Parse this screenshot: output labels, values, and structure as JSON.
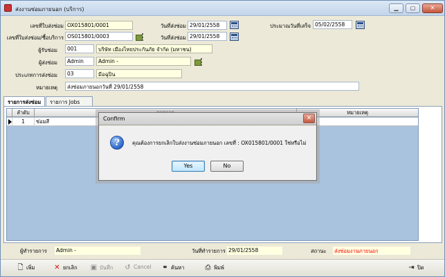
{
  "window": {
    "title": "ส่งงานซ่อมภายนอก (บริการ)",
    "controls": {
      "minimize": "▁",
      "maximize": "▢",
      "close": "✕"
    }
  },
  "form": {
    "doc_no_label": "เลขที่ใบส่งซ่อม",
    "doc_no_value": "OX015801/0001",
    "send_date_label": "วันที่ส่งซ่อม",
    "send_date_value": "29/01/2558",
    "est_finish_label": "ประมาณวันที่เสร็จ",
    "est_finish_value": "05/02/2558",
    "ref_no_label": "เลขที่ใบส่งซ่อม/ซื้อบริการ",
    "ref_no_value": "OS015801/0003",
    "ref_date_label": "วันที่ส่งซ่อม",
    "ref_date_value": "29/01/2558",
    "vendor_label": "ผู้รับซ่อม",
    "vendor_code": "001",
    "vendor_name": "บริษัท เมืองไทยประกันภัย จำกัด (มหาชน)",
    "sender_label": "ผู้ส่งซ่อม",
    "sender_code": "Admin",
    "sender_name": "Admin -",
    "type_label": "ประเภทการส่งซ่อม",
    "type_code": "03",
    "type_name": "มีอฉุปิน",
    "note_label": "หมายเหตุ",
    "note_value": "ส่งซ่อมภายนอกวันที่ 29/01/2558"
  },
  "tabs": [
    {
      "label": "รายการส่งซ่อม",
      "active": true
    },
    {
      "label": "รายการ Jobs",
      "active": false
    }
  ],
  "grid": {
    "columns": [
      "ลำดับ",
      "รายการ",
      "หมายเหตุ"
    ],
    "rows": [
      {
        "seq": "1",
        "item": "ซ่อมสี",
        "note": ""
      }
    ]
  },
  "footer": {
    "recorder_label": "ผู้ทำรายการ",
    "recorder_value": "Admin -",
    "record_date_label": "วันที่ทำรายการ",
    "record_date_value": "29/01/2558",
    "status_label": "สถานะ",
    "status_value": "ส่งซ่อมงานภายนอก"
  },
  "toolbar": {
    "add": "เพิ่ม",
    "cancel_doc": "ยกเลิก",
    "save": "บันทึก",
    "cancel": "Cancel",
    "search": "ค้นหา",
    "print": "พิมพ์",
    "close": "ปิด"
  },
  "dialog": {
    "title": "Confirm",
    "message": "คุณต้องการยกเลิกใบส่งงานซ่อมภายนอก เลขที่ : OX015801/0001 ใช่หรือไม่",
    "yes": "Yes",
    "no": "No",
    "close": "✕",
    "icon": "?"
  },
  "colors": {
    "field_bg": "#ffffe1",
    "grid_bg": "#a9c2dd",
    "status_text": "#ff0000"
  }
}
